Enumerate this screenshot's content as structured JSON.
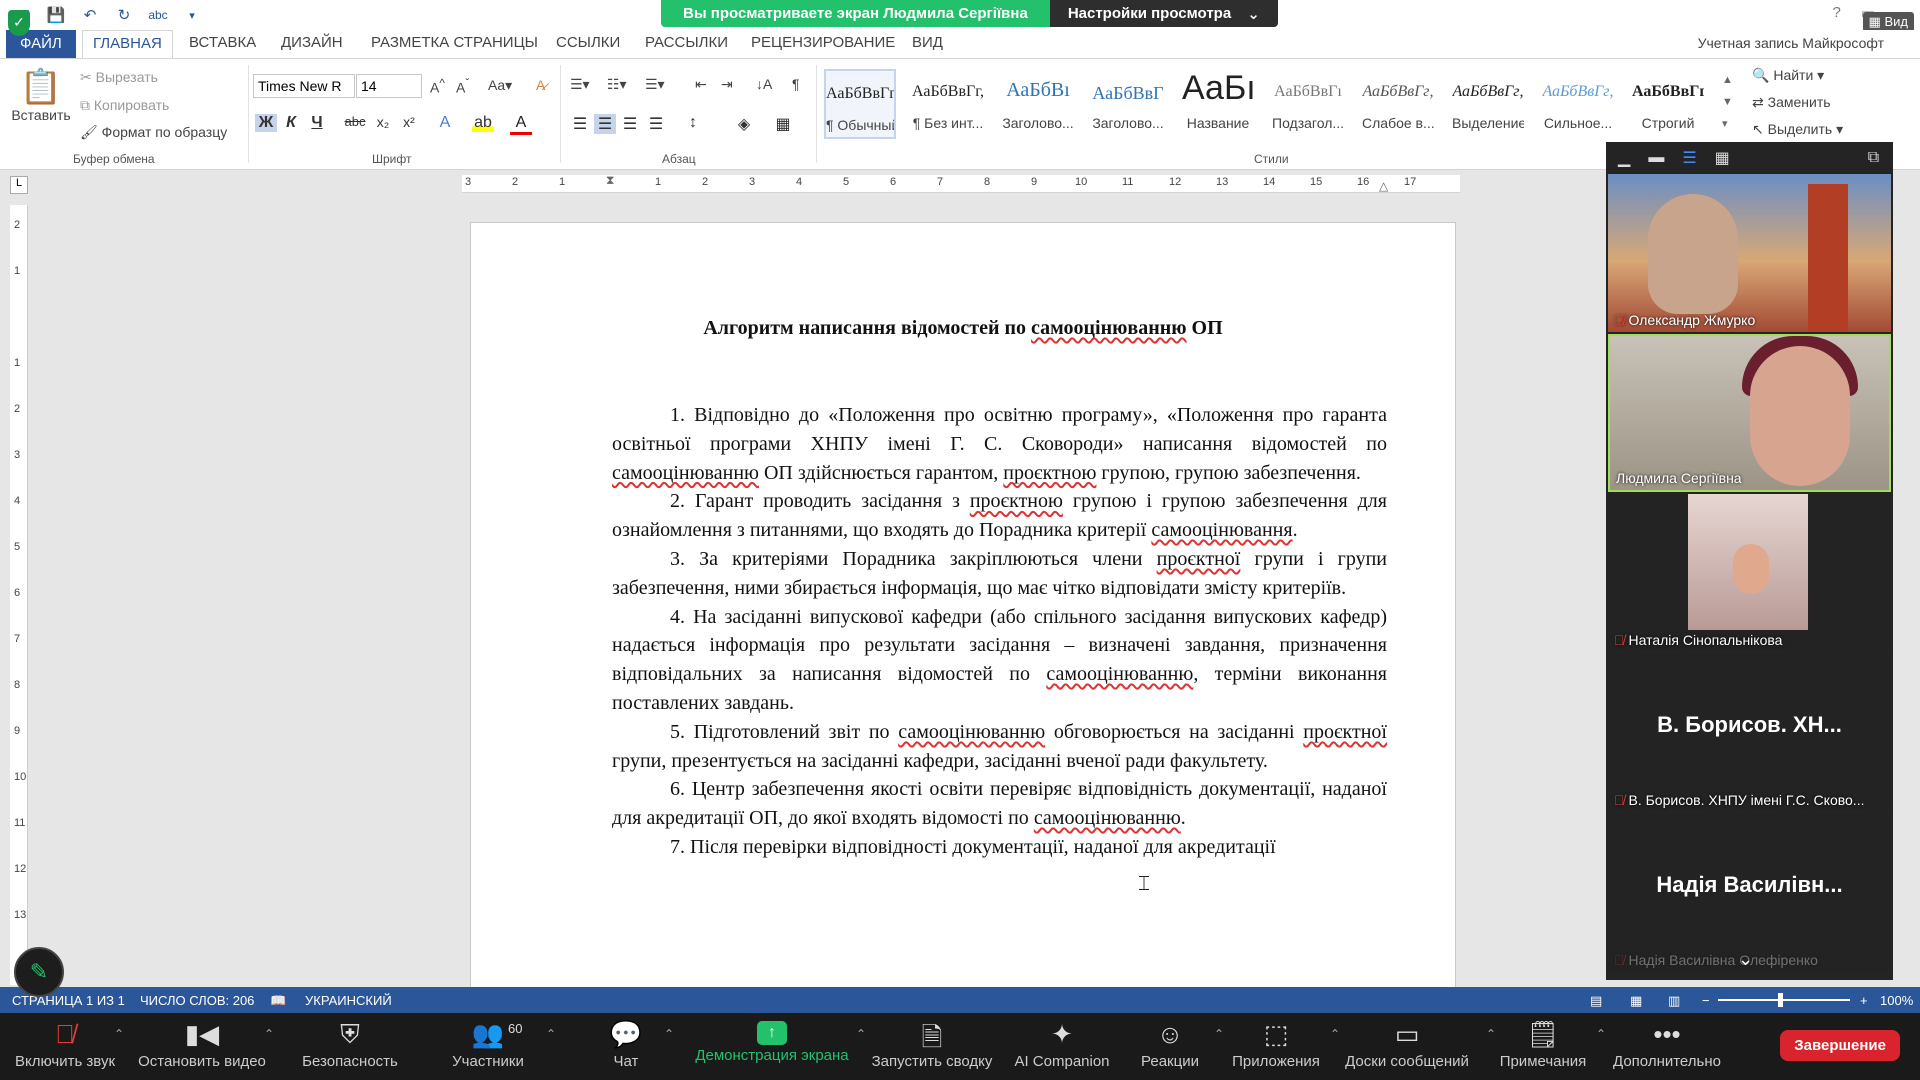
{
  "share_banner": {
    "viewing": "Вы просматриваете экран Людмила Сергіївна",
    "view_settings": "Настройки просмотра",
    "view_button": "Вид"
  },
  "tabs": [
    "ФАЙЛ",
    "ГЛАВНАЯ",
    "ВСТАВКА",
    "ДИЗАЙН",
    "РАЗМЕТКА СТРАНИЦЫ",
    "ССЫЛКИ",
    "РАССЫЛКИ",
    "РЕЦЕНЗИРОВАНИЕ",
    "ВИД"
  ],
  "account": "Учетная запись Майкрософт",
  "ribbon": {
    "clipboard": {
      "paste": "Вставить",
      "cut": "Вырезать",
      "copy": "Копировать",
      "format_painter": "Формат по образцу",
      "label": "Буфер обмена"
    },
    "font": {
      "name": "Times New R",
      "size": "14",
      "label": "Шрифт"
    },
    "paragraph": {
      "label": "Абзац"
    },
    "styles": {
      "label": "Стили",
      "items": [
        {
          "sample": "АаБбВвГг,",
          "label": "¶ Обычный"
        },
        {
          "sample": "АаБбВвГг,",
          "label": "¶ Без инт..."
        },
        {
          "sample": "АаБбВı",
          "label": "Заголово..."
        },
        {
          "sample": "АаБбВвГ",
          "label": "Заголово..."
        },
        {
          "sample": "АаБı",
          "label": "Название"
        },
        {
          "sample": "АаБбВвГı",
          "label": "Подзагол..."
        },
        {
          "sample": "АаБбВвГг,",
          "label": "Слабое в..."
        },
        {
          "sample": "АаБбВвГг,",
          "label": "Выделение"
        },
        {
          "sample": "АаБбВвГг,",
          "label": "Сильное..."
        },
        {
          "sample": "АаБбВвГг,",
          "label": "Строгий"
        }
      ]
    },
    "editing": {
      "find": "Найти",
      "replace": "Заменить",
      "select": "Выделить"
    }
  },
  "ruler": {
    "numbers": [
      "3",
      "2",
      "1",
      "1",
      "2",
      "3",
      "4",
      "5",
      "6",
      "7",
      "8",
      "9",
      "10",
      "11",
      "12",
      "13",
      "14",
      "15",
      "16",
      "17"
    ],
    "vertical_numbers": [
      "2",
      "1",
      "1",
      "2",
      "3",
      "4",
      "5",
      "6",
      "7",
      "8",
      "9",
      "10",
      "11",
      "12",
      "13"
    ],
    "corner": "L"
  },
  "document": {
    "title_pre": "Алгоритм написання відомостей по ",
    "title_sp": "самооцінюванню",
    "title_post": " ОП",
    "p1a": "1. Відповідно до  «Положення про освітню програму», «Положення про гаранта освітньої програми ХНПУ імені Г. С. Сковороди» написання відомостей по ",
    "p1b": "самооцінюванню",
    "p1c": "  ОП здійснюється гарантом, ",
    "p1d": "проєктною",
    "p1e": " групою, групою забезпечення.",
    "p2a": "2. Гарант проводить засідання з ",
    "p2b": "проєктною",
    "p2c": " групою і групою забезпечення для ознайомлення з питаннями, що входять до  Порадника критерії ",
    "p2d": "самооцінювання",
    "p2e": ".",
    "p3a": "3. За критеріями Порадника закріплюються члени ",
    "p3b": "проєктної",
    "p3c": " групи і групи забезпечення, ними збирається інформація, що має чітко відповідати змісту критеріїв.",
    "p4a": "4. На засіданні випускової кафедри (або спільного засідання випускових кафедр) надається інформація про результати засідання – визначені завдання, призначення відповідальних за написання відомостей по ",
    "p4b": "самооцінюванню",
    "p4c": ", терміни виконання поставлених завдань.",
    "p5a": "5. Підготовлений звіт по ",
    "p5b": "самооцінюванню",
    "p5c": " обговорюється на засіданні ",
    "p5d": "проєктної",
    "p5e": " групи, презентується на засіданні кафедри, засіданні вченої ради факультету.",
    "p6a": "6. Центр забезпечення якості освіти перевіряє відповідність документації, наданої для акредитації ОП, до якої входять відомості по ",
    "p6b": "самооцінюванню",
    "p6c": ".",
    "p7": "7. Після перевірки відповідності документації, наданої для акредитації"
  },
  "statusbar": {
    "page": "СТРАНИЦА 1 ИЗ 1",
    "words": "ЧИСЛО СЛОВ: 206",
    "language": "УКРАИНСКИЙ",
    "zoom": "100%"
  },
  "participants": [
    {
      "name": "Олександр Жмурко"
    },
    {
      "name": "Людмила Сергіївна"
    },
    {
      "name": "Наталія Сінопальнікова"
    },
    {
      "big": "В. Борисов. ХН...",
      "name": "В. Борисов. ХНПУ імені Г.С. Сково..."
    },
    {
      "big": "Надія Василівн...",
      "name": "Надія Василівна Олефіренко"
    }
  ],
  "zoom_toolbar": {
    "unmute": "Включить звук",
    "video": "Остановить видео",
    "security": "Безопасность",
    "participants": "Участники",
    "participants_count": "60",
    "chat": "Чат",
    "share": "Демонстрация экрана",
    "summary": "Запустить сводку",
    "ai": "AI Companion",
    "reactions": "Реакции",
    "apps": "Приложения",
    "whiteboards": "Доски сообщений",
    "notes": "Примечания",
    "more": "Дополнительно",
    "end": "Завершение"
  },
  "colors": {
    "word_blue": "#2b579a",
    "zoom_green": "#23c16b",
    "end_red": "#d9232d",
    "spell_red": "#d33"
  }
}
